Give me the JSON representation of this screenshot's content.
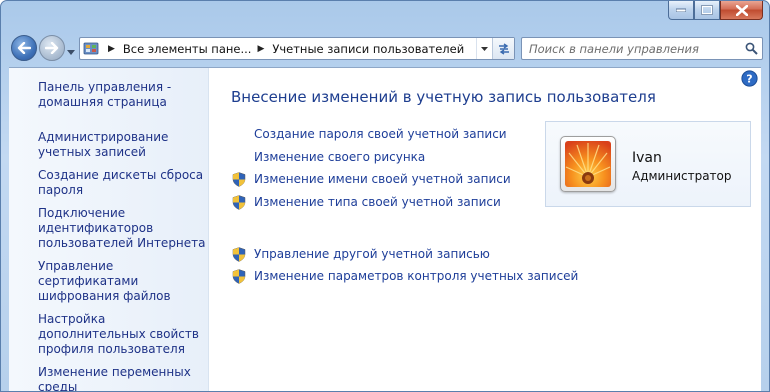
{
  "window": {
    "controls": [
      "minimize",
      "maximize",
      "close"
    ]
  },
  "address": {
    "segments": [
      "Все элементы пане...",
      "Учетные записи пользователей"
    ]
  },
  "search": {
    "placeholder": "Поиск в панели управления"
  },
  "sidebar": {
    "items": [
      {
        "label": "Панель управления - домашняя страница"
      },
      {
        "label": "Администрирование учетных записей"
      },
      {
        "label": "Создание дискеты сброса пароля"
      },
      {
        "label": "Подключение идентификаторов пользователей Интернета"
      },
      {
        "label": "Управление сертификатами шифрования файлов"
      },
      {
        "label": "Настройка дополнительных свойств профиля пользователя"
      },
      {
        "label": "Изменение переменных среды"
      }
    ]
  },
  "main": {
    "title": "Внесение изменений в учетную запись пользователя",
    "tasks": [
      {
        "label": "Создание пароля своей учетной записи",
        "icon": "none"
      },
      {
        "label": "Изменение своего рисунка",
        "icon": "none"
      },
      {
        "label": "Изменение имени своей учетной записи",
        "icon": "uac-shield-icon"
      },
      {
        "label": "Изменение типа своей учетной записи",
        "icon": "uac-shield-icon"
      },
      {
        "label": "Управление другой учетной записью",
        "icon": "uac-shield-icon"
      },
      {
        "label": "Изменение параметров контроля учетных записей",
        "icon": "uac-shield-icon"
      }
    ]
  },
  "user": {
    "name": "Ivan",
    "role": "Администратор",
    "picture": "orange-flower"
  },
  "colors": {
    "link": "#1e3e99",
    "title": "#1e3e8f",
    "frame": "#b6d0ec"
  }
}
